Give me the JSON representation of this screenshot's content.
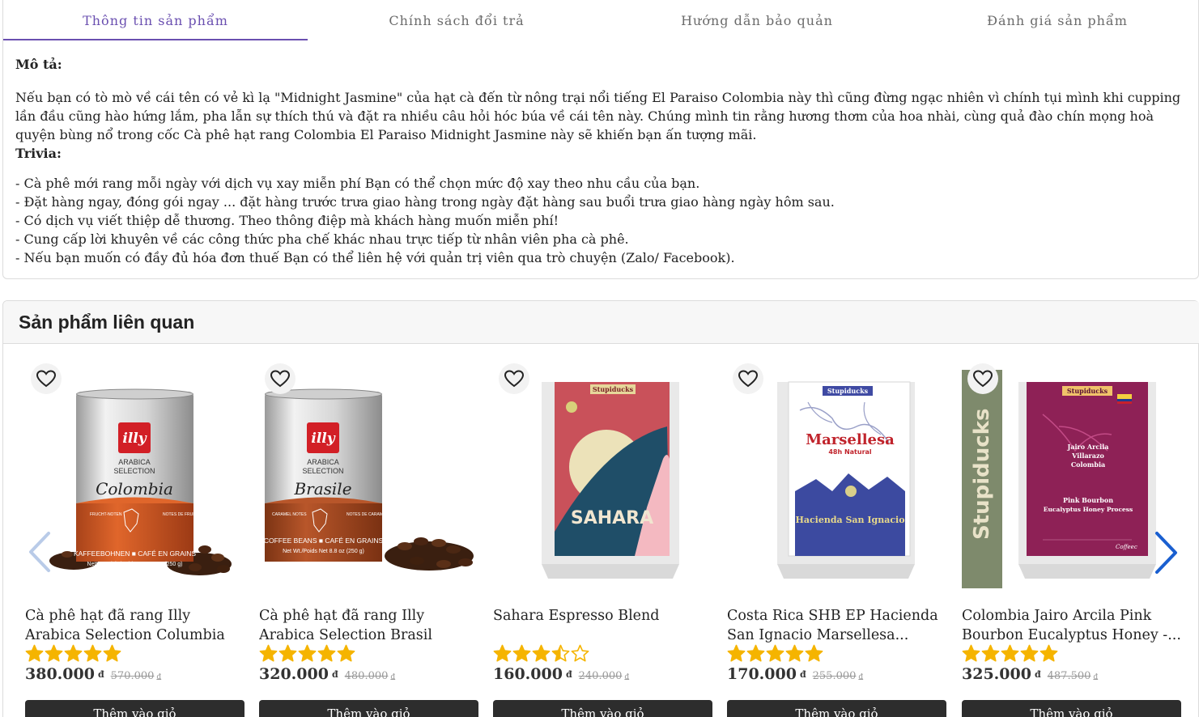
{
  "tabs": [
    {
      "label": "Thông tin sản phẩm",
      "active": true
    },
    {
      "label": "Chính sách đổi trả",
      "active": false
    },
    {
      "label": "Hướng dẫn bảo quản",
      "active": false
    },
    {
      "label": "Đánh giá sản phẩm",
      "active": false
    }
  ],
  "description": {
    "heading": "Mô tả:",
    "lines": [
      "Nếu bạn có tò mò về cái tên có vẻ kì lạ \"Midnight Jasmine\" của hạt cà đến từ nông trại nổi tiếng El Paraiso Colombia này thì cũng đừng ngạc nhiên vì chính tụi mình khi cupping",
      "lần đầu cũng hào hứng lắm, pha lẫn sự thích thú và đặt ra nhiều câu hỏi hóc búa về cái tên này. Chúng mình tin rằng hương thơm của hoa nhài, cùng quả đào chín mọng hoà",
      "quyện bùng nổ trong cốc Cà phê hạt rang Colombia El Paraiso Midnight Jasmine này sẽ khiến bạn ấn tượng mãi."
    ],
    "trivia_heading": "Trivia:",
    "trivia": [
      "- Cà phê mới rang mỗi ngày với dịch vụ xay miễn phí Bạn có thể chọn mức độ xay theo nhu cầu của bạn.",
      "- Đặt hàng ngay, đóng gói ngay ... đặt hàng trước trưa giao hàng trong ngày đặt hàng sau buổi trưa giao hàng ngày hôm sau.",
      "- Có dịch vụ viết thiệp dễ thương. Theo thông điệp mà khách hàng muốn miễn phí!",
      "- Cung cấp lời khuyên về các công thức pha chế khác nhau trực tiếp từ nhân viên pha cà phê.",
      "- Nếu bạn muốn có đầy đủ hóa đơn thuế Bạn có thể liên hệ với quản trị viên qua trò chuyện (Zalo/ Facebook)."
    ]
  },
  "related": {
    "title": "Sản phẩm liên quan",
    "cart_label": "Thêm vào giỏ",
    "currency": "đ",
    "products": [
      {
        "name": "Cà phê hạt đã rang Illy Arabica Selection Columbia",
        "rating": 5,
        "price": "380.000",
        "old_price": "570.000",
        "image": {
          "brand": "illy",
          "line1": "ARABICA",
          "line2": "SELECTION",
          "origin": "Colombia",
          "notes_left": "FRUCHT-NOTEN",
          "notes_right": "NOTES DE FRUITS",
          "band1": "KAFFEEBOHNEN ■ CAFÉ EN GRAINS",
          "band2": "Nettogewicht/Poids Net 8.8 oz (250 g)"
        }
      },
      {
        "name": "Cà phê hạt đã rang Illy Arabica Selection Brasil",
        "rating": 5,
        "price": "320.000",
        "old_price": "480.000",
        "image": {
          "brand": "illy",
          "line1": "ARABICA",
          "line2": "SELECTION",
          "origin": "Brasile",
          "notes_left": "CARAMEL NOTES",
          "notes_right": "NOTES DE CARAMEL",
          "band1": "COFFEE BEANS ■ CAFÉ EN GRAINS",
          "band2": "Net Wt./Poids Net 8.8 oz (250 g)"
        }
      },
      {
        "name": "Sahara Espresso Blend",
        "rating": 3.5,
        "price": "160.000",
        "old_price": "240.000",
        "image": {
          "brand": "Stupiducks",
          "title": "SAHARA"
        }
      },
      {
        "name": "Costa Rica SHB EP Hacienda San Ignacio Marsellesa...",
        "rating": 5,
        "price": "170.000",
        "old_price": "255.000",
        "image": {
          "brand": "Stupiducks",
          "title": "Marsellesa",
          "subtitle": "48h Natural",
          "farm": "Hacienda San Ignacio"
        }
      },
      {
        "name": "Colombia Jairo Arcila Pink Bourbon Eucalyptus Honey -...",
        "rating": 5,
        "price": "325.000",
        "old_price": "487.500",
        "image": {
          "brand": "Stupiducks",
          "side": "Stupiducks",
          "producer1": "Jairo Arcila",
          "producer2": "Villarazo",
          "producer3": "Colombia",
          "variety1": "Pink Bourbon",
          "variety2": "Eucalyptus Honey Process",
          "sign": "Coffeec"
        }
      }
    ]
  },
  "colors": {
    "accent": "#6a4fb0",
    "star": "#f5b400",
    "button": "#2d2d2d",
    "arrow": "#1a5fd0"
  },
  "icons": [
    "heart-icon",
    "star-icon",
    "chevron-left-icon",
    "chevron-right-icon"
  ]
}
